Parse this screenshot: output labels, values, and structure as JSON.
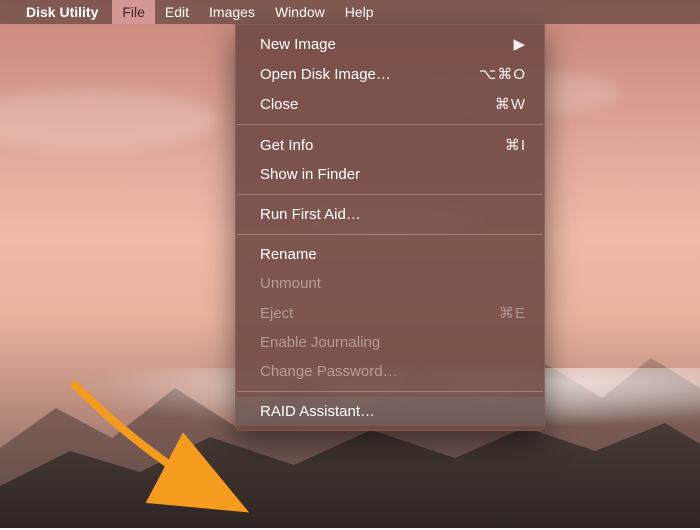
{
  "menubar": {
    "app_name": "Disk Utility",
    "items": [
      {
        "label": "File",
        "open": true
      },
      {
        "label": "Edit"
      },
      {
        "label": "Images"
      },
      {
        "label": "Window"
      },
      {
        "label": "Help"
      }
    ]
  },
  "dropdown": {
    "items": [
      {
        "label": "New Image",
        "shortcut": "",
        "submenu": true,
        "disabled": false,
        "highlight": false
      },
      {
        "label": "Open Disk Image…",
        "shortcut": "⌥⌘O",
        "disabled": false,
        "highlight": false
      },
      {
        "label": "Close",
        "shortcut": "⌘W",
        "disabled": false,
        "highlight": false
      },
      {
        "sep": true
      },
      {
        "label": "Get Info",
        "shortcut": "⌘I",
        "disabled": false,
        "highlight": false
      },
      {
        "label": "Show in Finder",
        "shortcut": "",
        "disabled": false,
        "highlight": false
      },
      {
        "sep": true
      },
      {
        "label": "Run First Aid…",
        "shortcut": "",
        "disabled": false,
        "highlight": false
      },
      {
        "sep": true
      },
      {
        "label": "Rename",
        "shortcut": "",
        "disabled": false,
        "highlight": false
      },
      {
        "label": "Unmount",
        "shortcut": "",
        "disabled": true,
        "highlight": false
      },
      {
        "label": "Eject",
        "shortcut": "⌘E",
        "disabled": true,
        "highlight": false
      },
      {
        "label": "Enable Journaling",
        "shortcut": "",
        "disabled": true,
        "highlight": false
      },
      {
        "label": "Change Password…",
        "shortcut": "",
        "disabled": true,
        "highlight": false
      },
      {
        "sep": true
      },
      {
        "label": "RAID Assistant…",
        "shortcut": "",
        "disabled": false,
        "highlight": true
      }
    ]
  },
  "annotation": {
    "arrow_color": "#f59b1e"
  }
}
